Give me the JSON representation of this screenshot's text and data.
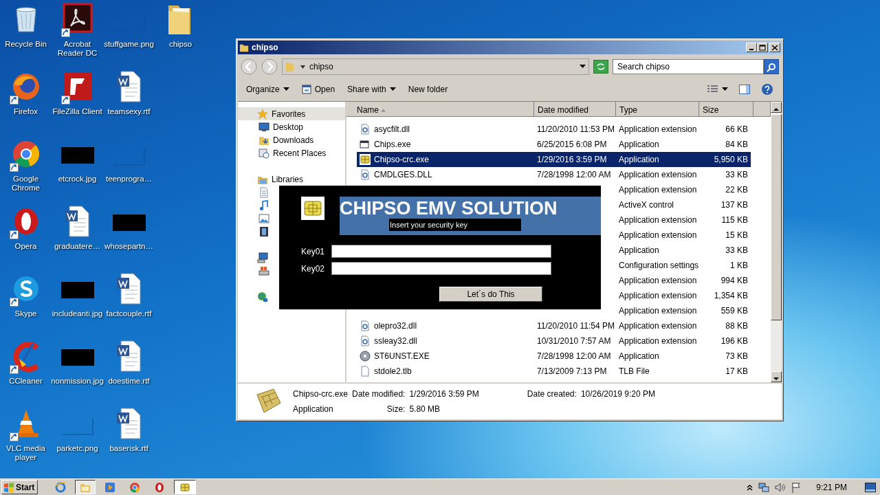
{
  "desktop": {
    "icons": [
      {
        "label": "Recycle Bin",
        "kind": "recycle",
        "shortcut": false
      },
      {
        "label": "Firefox",
        "kind": "firefox",
        "shortcut": true
      },
      {
        "label": "Google Chrome",
        "kind": "chrome",
        "shortcut": true
      },
      {
        "label": "Opera",
        "kind": "opera",
        "shortcut": true
      },
      {
        "label": "Skype",
        "kind": "skype",
        "shortcut": true
      },
      {
        "label": "CCleaner",
        "kind": "ccleaner",
        "shortcut": true
      },
      {
        "label": "VLC media player",
        "kind": "vlc",
        "shortcut": true
      },
      {
        "label": "Acrobat Reader DC",
        "kind": "pdf",
        "shortcut": true
      },
      {
        "label": "FileZilla Client",
        "kind": "filezilla",
        "shortcut": true
      },
      {
        "label": "etcrock.jpg",
        "kind": "photo",
        "shortcut": false
      },
      {
        "label": "graduatere…",
        "kind": "word",
        "shortcut": false
      },
      {
        "label": "includeanti.jpg",
        "kind": "photo",
        "shortcut": false
      },
      {
        "label": "nonmission.jpg",
        "kind": "photo",
        "shortcut": false
      },
      {
        "label": "parketc.png",
        "kind": "blank",
        "shortcut": false
      },
      {
        "label": "stuffgame.png",
        "kind": "blank",
        "shortcut": false
      },
      {
        "label": "teamsexy.rtf",
        "kind": "word",
        "shortcut": false
      },
      {
        "label": "teenprogra…",
        "kind": "blank",
        "shortcut": false
      },
      {
        "label": "whosepartn…",
        "kind": "photo",
        "shortcut": false
      },
      {
        "label": "factcouple.rtf",
        "kind": "word",
        "shortcut": false
      },
      {
        "label": "doestime.rtf",
        "kind": "word",
        "shortcut": false
      },
      {
        "label": "baserisk.rtf",
        "kind": "word",
        "shortcut": false
      },
      {
        "label": "chipso",
        "kind": "folder",
        "shortcut": false
      }
    ]
  },
  "explorer": {
    "title": "chipso",
    "address": "chipso",
    "search": {
      "placeholder": "Search chipso"
    },
    "toolbar": [
      {
        "label": "Organize",
        "kind": "menu"
      },
      {
        "label": "Open",
        "kind": "open"
      },
      {
        "label": "Share with",
        "kind": "menu"
      },
      {
        "label": "New folder",
        "kind": "plain"
      }
    ],
    "nav": [
      {
        "label": "Favorites",
        "kind": "star",
        "selected": true,
        "children": [
          {
            "label": "Desktop",
            "kind": "desktop",
            "selected": false
          },
          {
            "label": "Downloads",
            "kind": "downloads",
            "selected": false
          },
          {
            "label": "Recent Places",
            "kind": "recent",
            "selected": false
          }
        ]
      },
      {
        "label": "Libraries",
        "kind": "libraries",
        "selected": false,
        "children": [
          {
            "kind": "documents",
            "selected": false
          },
          {
            "kind": "music",
            "selected": false
          },
          {
            "kind": "pictures",
            "selected": false
          },
          {
            "kind": "videos",
            "selected": false
          }
        ]
      },
      {
        "kind": "computer",
        "selected": false,
        "children": [
          {
            "kind": "disk",
            "selected": false
          }
        ]
      },
      {
        "kind": "network",
        "selected": false
      }
    ],
    "columns": [
      "Name",
      "Date modified",
      "Type",
      "Size"
    ],
    "files": [
      {
        "name": "asycfilt.dll",
        "date": "11/20/2010 11:53 PM",
        "type": "Application extension",
        "size": "66 KB",
        "kind": "dll",
        "selected": false
      },
      {
        "name": "Chips.exe",
        "date": "6/25/2015 6:08 PM",
        "type": "Application",
        "size": "84 KB",
        "kind": "exe",
        "selected": false
      },
      {
        "name": "Chipso-crc.exe",
        "date": "1/29/2016 3:59 PM",
        "type": "Application",
        "size": "5,950 KB",
        "kind": "chip",
        "selected": true
      },
      {
        "name": "CMDLGES.DLL",
        "date": "7/28/1998 12:00 AM",
        "type": "Application extension",
        "size": "33 KB",
        "kind": "dll",
        "selected": false
      },
      {
        "type": "Application extension",
        "size": "22 KB",
        "selected": false
      },
      {
        "type": "ActiveX control",
        "size": "137 KB",
        "selected": false
      },
      {
        "type": "Application extension",
        "size": "115 KB",
        "selected": false
      },
      {
        "type": "Application extension",
        "size": "15 KB",
        "selected": false
      },
      {
        "type": "Application",
        "size": "33 KB",
        "selected": false
      },
      {
        "type": "Configuration settings",
        "size": "1 KB",
        "selected": false
      },
      {
        "type": "Application extension",
        "size": "994 KB",
        "selected": false
      },
      {
        "type": "Application extension",
        "size": "1,354 KB",
        "selected": false
      },
      {
        "type": "Application extension",
        "size": "559 KB",
        "selected": false
      },
      {
        "name": "olepro32.dll",
        "date": "11/20/2010 11:54 PM",
        "type": "Application extension",
        "size": "88 KB",
        "kind": "dll",
        "selected": false
      },
      {
        "name": "ssleay32.dll",
        "date": "10/31/2010 7:57 AM",
        "type": "Application extension",
        "size": "196 KB",
        "kind": "dll",
        "selected": false
      },
      {
        "name": "ST6UNST.EXE",
        "date": "7/28/1998 12:00 AM",
        "type": "Application",
        "size": "73 KB",
        "kind": "setup",
        "selected": false
      },
      {
        "name": "stdole2.tlb",
        "date": "7/13/2009 7:13 PM",
        "type": "TLB File",
        "size": "17 KB",
        "kind": "blank",
        "selected": false
      }
    ],
    "details": {
      "name": "Chipso-crc.exe",
      "type": "Application",
      "fields": [
        {
          "label": "Date modified:",
          "value": "1/29/2016 3:59 PM"
        },
        {
          "label": "Date created:",
          "value": "10/26/2019 9:20 PM"
        },
        {
          "label": "Size:",
          "value": "5.80 MB"
        }
      ]
    }
  },
  "dialog": {
    "title": "CHIPSO EMV  SOLUTION",
    "subtitle": "Insert your security key",
    "fields": [
      {
        "label": "Key01"
      },
      {
        "label": "Key02"
      }
    ],
    "button": "Let´s do This"
  },
  "taskbar": {
    "start": "Start",
    "apps": [
      {
        "kind": "ie",
        "active": false
      },
      {
        "kind": "explorer",
        "active": true
      },
      {
        "kind": "media",
        "active": false
      },
      {
        "kind": "chrome",
        "active": false
      },
      {
        "kind": "opera",
        "active": false
      },
      {
        "kind": "chip",
        "active": true
      }
    ],
    "clock": "9:21 PM"
  }
}
